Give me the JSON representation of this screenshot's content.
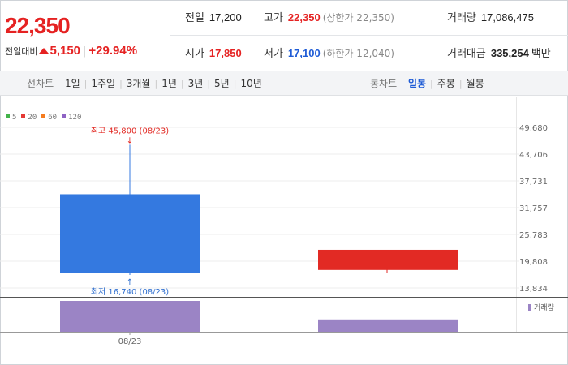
{
  "quote": {
    "price": "22,350",
    "change_label": "전일대비",
    "change_value": "5,150",
    "change_rate": "+29.94%",
    "prev_close_label": "전일",
    "prev_close": "17,200",
    "high_label": "고가",
    "high": "22,350",
    "high_note": "(상한가 22,350)",
    "volume_label": "거래량",
    "volume": "17,086,475",
    "open_label": "시가",
    "open": "17,850",
    "low_label": "저가",
    "low": "17,100",
    "low_note": "(하한가 12,040)",
    "amount_label": "거래대금",
    "amount": "335,254",
    "amount_unit": "백만"
  },
  "tabs": {
    "line_title": "선차트",
    "line": [
      "1일",
      "1주일",
      "3개월",
      "1년",
      "3년",
      "5년",
      "10년"
    ],
    "candle_title": "봉차트",
    "candle": [
      "일봉",
      "주봉",
      "월봉"
    ],
    "candle_active": 0
  },
  "legend": [
    {
      "label": "5",
      "color": "#43b34a"
    },
    {
      "label": "20",
      "color": "#e53935"
    },
    {
      "label": "60",
      "color": "#f57c1f"
    },
    {
      "label": "120",
      "color": "#8e63c4"
    }
  ],
  "volume_legend": {
    "label": "거래량",
    "color": "#9b84c5"
  },
  "colors": {
    "up": "#e22a24",
    "down": "#3479e0",
    "volume": "#9b84c5",
    "max_note": "#e22a24",
    "min_note": "#2f6fcf"
  },
  "chart_data": {
    "type": "candlestick",
    "y_ticks": [
      "49,680",
      "43,706",
      "37,731",
      "31,757",
      "25,783",
      "19,808",
      "13,834"
    ],
    "ylim": [
      13834,
      49680
    ],
    "x_tick_labels": [
      "08/23"
    ],
    "candles": [
      {
        "date": "08/23",
        "open": 34750,
        "high": 45800,
        "low": 16740,
        "close": 17150,
        "volume_ratio": 1.0
      },
      {
        "date": "",
        "open": 17850,
        "high": 22350,
        "low": 17100,
        "close": 22350,
        "volume_ratio": 0.4
      }
    ],
    "annotations": {
      "max_text": "최고 45,800 (08/23)",
      "min_text": "최저 16,740 (08/23)"
    }
  }
}
